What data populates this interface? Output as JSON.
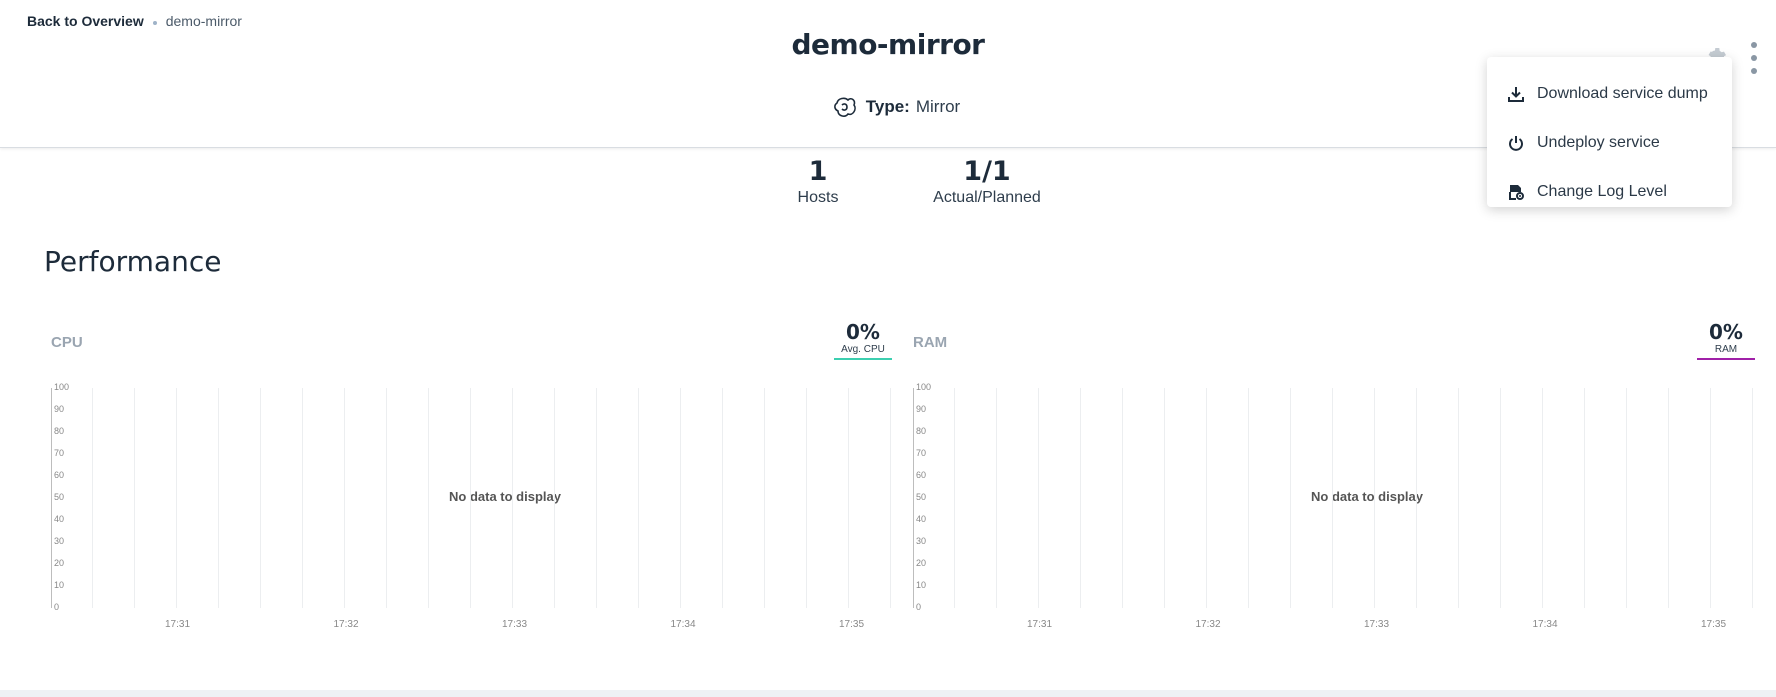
{
  "breadcrumb": {
    "back_label": "Back to Overview",
    "current": "demo-mirror"
  },
  "service": {
    "title": "demo-mirror",
    "type_label": "Type:",
    "type_value": "Mirror"
  },
  "header_icons": {
    "settings": "gear-icon",
    "more": "kebab-menu-icon"
  },
  "menu": {
    "items": [
      {
        "label": "Download service dump",
        "icon": "download-icon"
      },
      {
        "label": "Undeploy service",
        "icon": "power-icon"
      },
      {
        "label": "Change Log Level",
        "icon": "log-level-icon"
      }
    ]
  },
  "stats": [
    {
      "value": "1",
      "label": "Hosts"
    },
    {
      "value": "1/1",
      "label": "Actual/Planned"
    }
  ],
  "performance": {
    "title": "Performance"
  },
  "charts": [
    {
      "title": "CPU",
      "legend_value": "0%",
      "legend_label": "Avg. CPU",
      "legend_color": "#3ccfb0",
      "no_data": "No data to display"
    },
    {
      "title": "RAM",
      "legend_value": "0%",
      "legend_label": "RAM",
      "legend_color": "#a020a8",
      "no_data": "No data to display"
    }
  ],
  "chart_data": [
    {
      "type": "line",
      "title": "CPU",
      "series": [
        {
          "name": "Avg. CPU",
          "values": []
        }
      ],
      "ylim": [
        0,
        100
      ],
      "y_ticks": [
        "0",
        "10",
        "20",
        "30",
        "40",
        "50",
        "60",
        "70",
        "80",
        "90",
        "100"
      ],
      "x_ticks": [
        "17:31",
        "17:32",
        "17:33",
        "17:34",
        "17:35"
      ],
      "grid": true
    },
    {
      "type": "line",
      "title": "RAM",
      "series": [
        {
          "name": "RAM",
          "values": []
        }
      ],
      "ylim": [
        0,
        100
      ],
      "y_ticks": [
        "0",
        "10",
        "20",
        "30",
        "40",
        "50",
        "60",
        "70",
        "80",
        "90",
        "100"
      ],
      "x_ticks": [
        "17:31",
        "17:32",
        "17:33",
        "17:34",
        "17:35"
      ],
      "grid": true
    }
  ]
}
